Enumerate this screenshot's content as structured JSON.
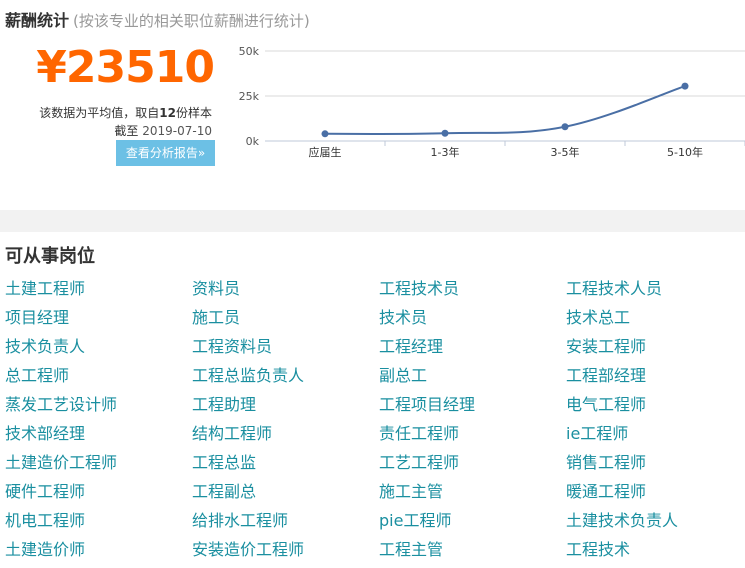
{
  "salary": {
    "title": "薪酬统计",
    "subtitle": "(按该专业的相关职位薪酬进行统计)",
    "value": "¥23510",
    "sample_prefix": "该数据为平均值，取自",
    "sample_count": "12",
    "sample_suffix": "份样本",
    "date_prefix": "截至",
    "date": "2019-07-10",
    "report_button": "查看分析报告»"
  },
  "chart_data": {
    "type": "line",
    "categories": [
      "应届生",
      "1-3年",
      "3-5年",
      "5-10年"
    ],
    "values": [
      4000,
      4300,
      7900,
      30500
    ],
    "yticks": [
      "0k",
      "25k",
      "50k"
    ],
    "ylim": [
      0,
      50000
    ],
    "grid": true,
    "line_color": "#4a6fa5"
  },
  "positions": {
    "title": "可从事岗位",
    "link_color": "#1a8fa0",
    "items": [
      "土建工程师",
      "资料员",
      "工程技术员",
      "工程技术人员",
      "项目经理",
      "施工员",
      "技术员",
      "技术总工",
      "技术负责人",
      "工程资料员",
      "工程经理",
      "安装工程师",
      "总工程师",
      "工程总监负责人",
      "副总工",
      "工程部经理",
      "蒸发工艺设计师",
      "工程助理",
      "工程项目经理",
      "电气工程师",
      "技术部经理",
      "结构工程师",
      "责任工程师",
      "ie工程师",
      "土建造价工程师",
      "工程总监",
      "工艺工程师",
      "销售工程师",
      "硬件工程师",
      "工程副总",
      "施工主管",
      "暖通工程师",
      "机电工程师",
      "给排水工程师",
      "pie工程师",
      "土建技术负责人",
      "土建造价师",
      "安装造价工程师",
      "工程主管",
      "工程技术"
    ]
  }
}
